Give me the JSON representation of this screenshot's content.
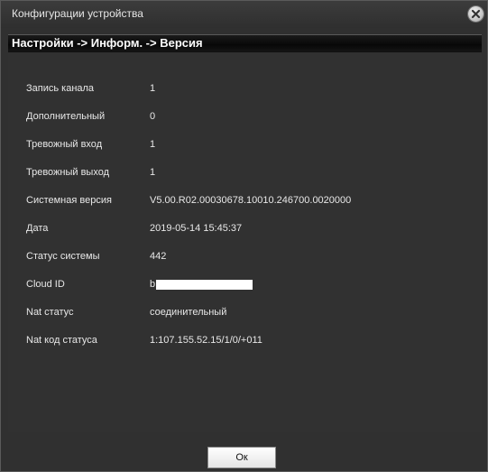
{
  "window": {
    "title": "Конфигурации устройства",
    "close_icon": "close-icon"
  },
  "breadcrumb": "Настройки -> Информ. -> Версия",
  "info": {
    "rows": [
      {
        "label": "Запись канала",
        "value": "1"
      },
      {
        "label": "Дополнительный",
        "value": "0"
      },
      {
        "label": "Тревожный вход",
        "value": "1"
      },
      {
        "label": "Тревожный выход",
        "value": "1"
      },
      {
        "label": "Системная версия",
        "value": "V5.00.R02.00030678.10010.246700.0020000"
      },
      {
        "label": "Дата",
        "value": "2019-05-14 15:45:37"
      },
      {
        "label": "Статус системы",
        "value": "442"
      },
      {
        "label": "Cloud ID",
        "value": "b",
        "redacted": true
      },
      {
        "label": "Nat статус",
        "value": "соединительный"
      },
      {
        "label": "Nat код статуса",
        "value": "1:107.155.52.15/1/0/+011"
      }
    ]
  },
  "footer": {
    "ok_label": "Ок"
  },
  "colors": {
    "background": "#303030",
    "breadcrumb_bar": "#0a0a0a",
    "text": "#e8e8e8"
  }
}
